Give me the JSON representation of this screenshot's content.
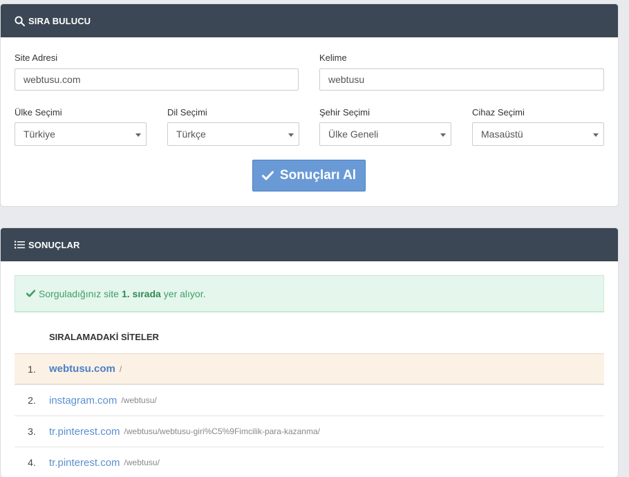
{
  "finder": {
    "title": "SIRA BULUCU",
    "site_label": "Site Adresi",
    "site_value": "webtusu.com",
    "keyword_label": "Kelime",
    "keyword_value": "webtusu",
    "country_label": "Ülke Seçimi",
    "country_value": "Türkiye",
    "language_label": "Dil Seçimi",
    "language_value": "Türkçe",
    "city_label": "Şehir Seçimi",
    "city_value": "Ülke Geneli",
    "device_label": "Cihaz Seçimi",
    "device_value": "Masaüstü",
    "submit_label": "Sonuçları Al"
  },
  "results": {
    "title": "SONUÇLAR",
    "alert_prefix": "Sorguladığınız site",
    "alert_rank": "1. sırada",
    "alert_suffix": "yer alıyor.",
    "table_header": "SIRALAMADAKİ SİTELER",
    "rows": [
      {
        "rank": "1.",
        "domain": "webtusu.com",
        "path": "/"
      },
      {
        "rank": "2.",
        "domain": "instagram.com",
        "path": "/webtusu/"
      },
      {
        "rank": "3.",
        "domain": "tr.pinterest.com",
        "path": "/webtusu/webtusu-giri%C5%9Fimcilik-para-kazanma/"
      },
      {
        "rank": "4.",
        "domain": "tr.pinterest.com",
        "path": "/webtusu/"
      }
    ]
  },
  "colors": {
    "header_bg": "#3c4755",
    "button_bg": "#6a9ad6",
    "alert_bg": "#e5f6ec",
    "highlight_row_bg": "#fbf1e4",
    "link": "#5b8fd1"
  }
}
